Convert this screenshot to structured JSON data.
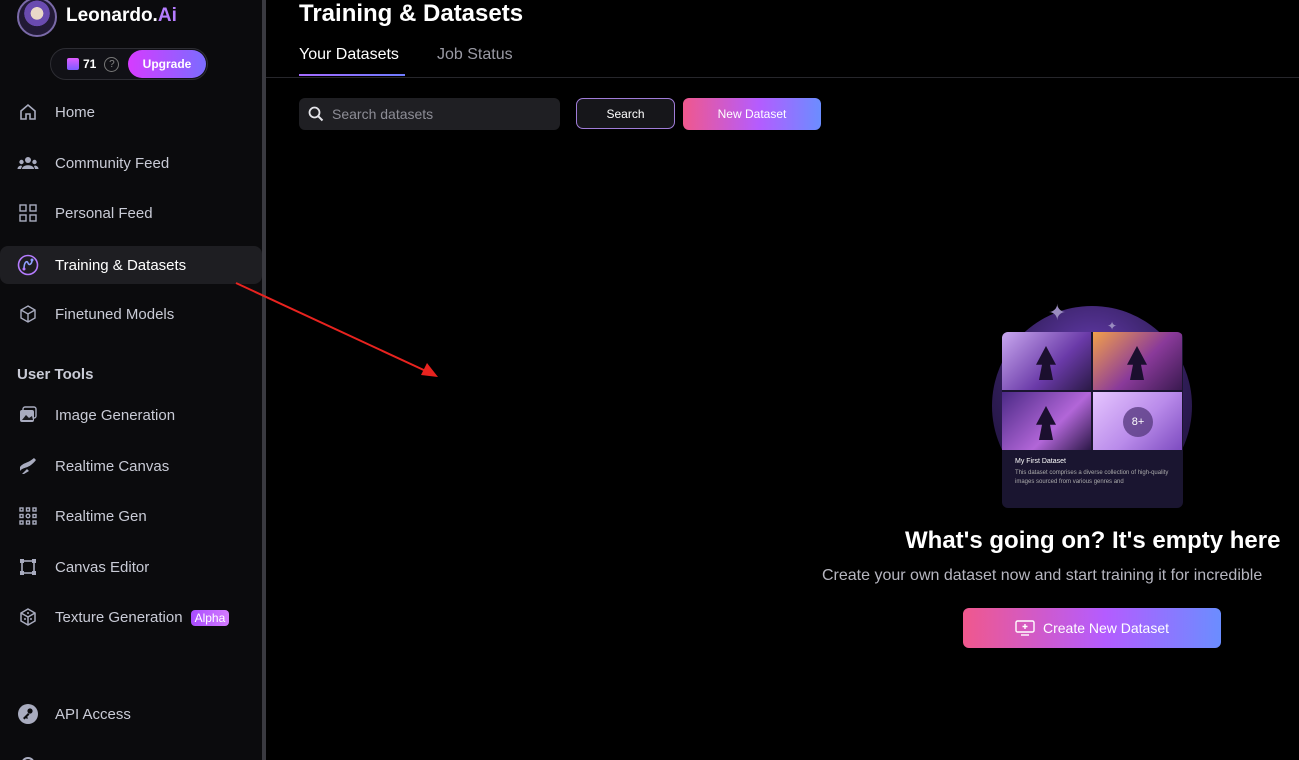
{
  "brand": {
    "name": "Leonardo.",
    "suffix": "Ai"
  },
  "credits": {
    "count": "71",
    "help": "?",
    "upgrade_label": "Upgrade"
  },
  "nav": {
    "items": [
      {
        "label": "Home",
        "icon": "home-icon"
      },
      {
        "label": "Community Feed",
        "icon": "community-icon"
      },
      {
        "label": "Personal Feed",
        "icon": "grid-icon"
      },
      {
        "label": "Training & Datasets",
        "icon": "training-icon",
        "active": true
      },
      {
        "label": "Finetuned Models",
        "icon": "cube-icon"
      }
    ],
    "user_tools_title": "User Tools",
    "tools": [
      {
        "label": "Image Generation",
        "icon": "image-icon"
      },
      {
        "label": "Realtime Canvas",
        "icon": "brush-icon"
      },
      {
        "label": "Realtime Gen",
        "icon": "dots-grid-icon"
      },
      {
        "label": "Canvas Editor",
        "icon": "canvas-icon"
      },
      {
        "label": "Texture Generation",
        "icon": "texture-icon",
        "badge": "Alpha"
      }
    ],
    "bottom": [
      {
        "label": "API Access",
        "icon": "key-icon"
      }
    ]
  },
  "page": {
    "title": "Training & Datasets",
    "tabs": [
      {
        "label": "Your Datasets",
        "active": true
      },
      {
        "label": "Job Status",
        "active": false
      }
    ]
  },
  "toolbar": {
    "search_placeholder": "Search datasets",
    "search_button": "Search",
    "new_dataset_button": "New Dataset"
  },
  "empty_state": {
    "card_title": "My First Dataset",
    "card_desc": "This dataset comprises a diverse collection of high-quality images sourced from various genres and",
    "more_badge": "8+",
    "title": "What's going on? It's empty here",
    "subtitle": "Create your own dataset now and start training it for incredible",
    "create_button": "Create New Dataset"
  },
  "colors": {
    "accent_start": "#f0588d",
    "accent_mid": "#b45cff",
    "accent_end": "#6b8dff",
    "annotation_arrow": "#e8231f"
  }
}
